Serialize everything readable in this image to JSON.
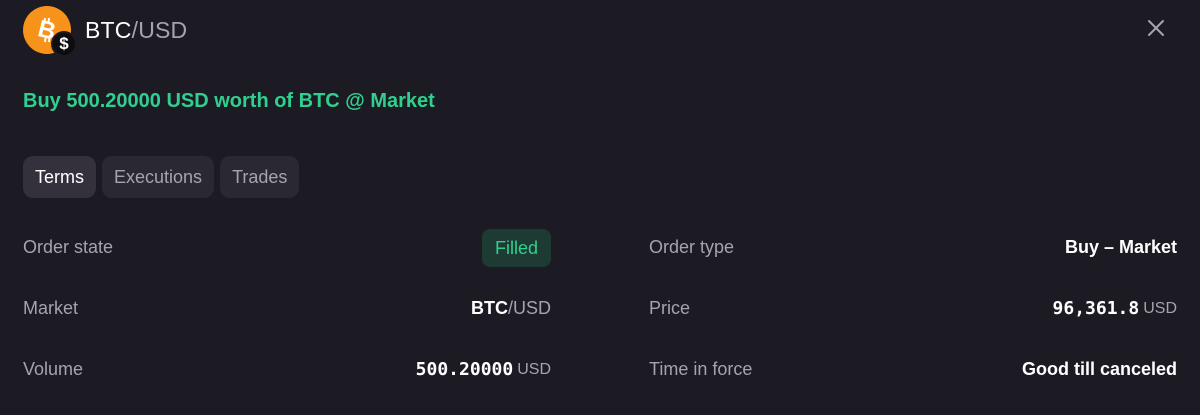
{
  "header": {
    "pair_base": "BTC",
    "pair_separator": "/",
    "pair_quote": "USD",
    "base_icon": "bitcoin-icon",
    "quote_icon": "dollar-icon",
    "quote_icon_glyph": "$",
    "close_icon": "close-icon"
  },
  "summary": "Buy 500.20000 USD worth of BTC @ Market",
  "tabs": [
    {
      "label": "Terms",
      "active": true
    },
    {
      "label": "Executions",
      "active": false
    },
    {
      "label": "Trades",
      "active": false
    }
  ],
  "details": {
    "order_state": {
      "label": "Order state",
      "value": "Filled"
    },
    "order_type": {
      "label": "Order type",
      "value": "Buy – Market"
    },
    "market": {
      "label": "Market",
      "base": "BTC",
      "separator": "/",
      "quote": "USD"
    },
    "price": {
      "label": "Price",
      "value": "96,361.8",
      "unit": "USD"
    },
    "volume": {
      "label": "Volume",
      "value": "500.20000",
      "unit": "USD"
    },
    "time_in_force": {
      "label": "Time in force",
      "value": "Good till canceled"
    }
  },
  "colors": {
    "background": "#1c1a23",
    "accent_green": "#2fd08f",
    "muted_text": "#a6a3b0",
    "bitcoin_orange": "#f7931a"
  }
}
